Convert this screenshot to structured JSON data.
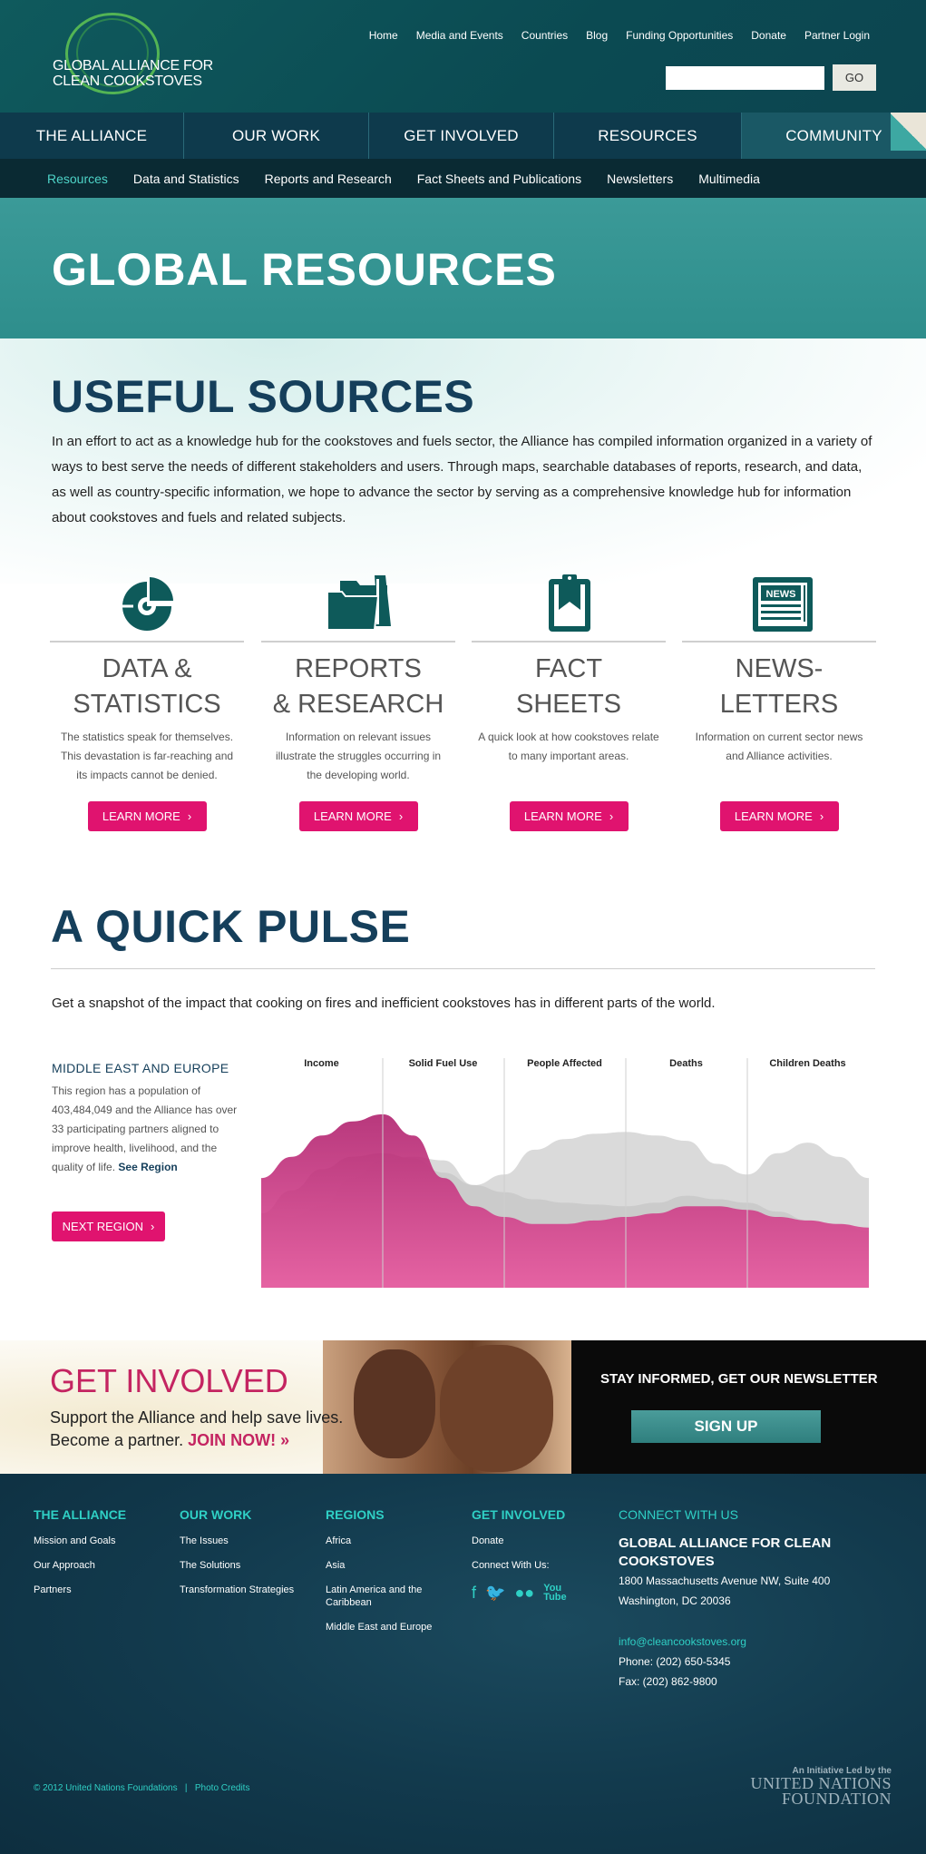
{
  "header": {
    "logo_line1": "GLOBAL ALLIANCE FOR",
    "logo_line2": "CLEAN COOKSTOVES",
    "utility_nav": [
      "Home",
      "Media and Events",
      "Countries",
      "Blog",
      "Funding Opportunities",
      "Donate",
      "Partner Login"
    ],
    "search": {
      "value": "",
      "placeholder": "",
      "button": "GO"
    }
  },
  "main_nav": [
    {
      "label": "THE ALLIANCE",
      "active": false
    },
    {
      "label": "OUR WORK",
      "active": false
    },
    {
      "label": "GET INVOLVED",
      "active": false
    },
    {
      "label": "RESOURCES",
      "active": false
    },
    {
      "label": "COMMUNITY",
      "active": true
    }
  ],
  "sub_nav": {
    "current": "Resources",
    "items": [
      "Resources",
      "Data and Statistics",
      "Reports and Research",
      "Fact Sheets and Publications",
      "Newsletters",
      "Multimedia"
    ]
  },
  "banner": {
    "title": "GLOBAL RESOURCES"
  },
  "useful_sources": {
    "title": "USEFUL SOURCES",
    "text": "In an effort to act as a knowledge hub for the cookstoves and fuels sector, the Alliance has compiled information organized in a variety of ways to best serve the needs of different stakeholders and users. Through maps, searchable databases of reports, research, and data, as well as country-specific information, we hope to advance the sector by serving as a comprehensive knowledge hub for information about cookstoves and fuels and related subjects."
  },
  "resources": [
    {
      "icon": "data-chart-icon",
      "title_1": "DATA &",
      "title_2": "STATISTICS",
      "desc": "The statistics speak for themselves. This devastation is far-reaching and its impacts cannot be denied.",
      "button": "LEARN MORE"
    },
    {
      "icon": "folder-icon",
      "title_1": "REPORTS",
      "title_2": "& RESEARCH",
      "desc": "Information on relevant issues illustrate the struggles occurring in the developing world.",
      "button": "LEARN MORE"
    },
    {
      "icon": "clipboard-icon",
      "title_1": "FACT",
      "title_2": "SHEETS",
      "desc": "A quick look at how cookstoves relate to many important areas.",
      "button": "LEARN MORE"
    },
    {
      "icon": "newspaper-icon",
      "title_1": "NEWS-",
      "title_2": "LETTERS",
      "desc": "Information on current sector news and Alliance activities.",
      "button": "LEARN MORE",
      "icon_text": "NEWS"
    }
  ],
  "pulse": {
    "title": "A QUICK PULSE",
    "intro": "Get a snapshot of the impact that cooking on fires and inefficient cookstoves has in different parts of the world.",
    "region": {
      "name": "MIDDLE EAST AND EUROPE",
      "desc": "This region has a population of 403,484,049 and the Alliance has over 33 participating partners aligned to improve health, livelihood, and the quality of life.",
      "link": "See Region",
      "next_button": "NEXT REGION"
    }
  },
  "chart_data": {
    "type": "area",
    "categories": [
      "Income",
      "Solid Fuel Use",
      "People Affected",
      "Deaths",
      "Children Deaths"
    ],
    "x": [
      0,
      0.25,
      0.5,
      0.75,
      1,
      1.25,
      1.5,
      1.75,
      2,
      2.25,
      2.5,
      2.75,
      3,
      3.25,
      3.5,
      3.75,
      4,
      4.25,
      4.5,
      4.75,
      5
    ],
    "series": [
      {
        "values": [
          42,
          40,
          46,
          62,
          72,
          74,
          72,
          58,
          64,
          78,
          84,
          87,
          88,
          86,
          83,
          70,
          64,
          76,
          82,
          74,
          62
        ],
        "color": "#d4d4d4"
      },
      {
        "values": [
          42,
          55,
          67,
          74,
          76,
          73,
          65,
          58,
          54,
          50,
          48,
          47,
          46,
          48,
          52,
          50,
          48,
          43,
          38,
          36,
          32
        ],
        "color": "#c8c8c8"
      },
      {
        "values": [
          62,
          74,
          86,
          94,
          98,
          86,
          62,
          46,
          40,
          36,
          36,
          38,
          40,
          42,
          46,
          46,
          44,
          40,
          38,
          36,
          34
        ],
        "color": "#d12a83"
      }
    ],
    "ylim": [
      0,
      100
    ],
    "grid": "vertical",
    "legend": "none"
  },
  "get_involved": {
    "title": "GET INVOLVED",
    "line1": "Support the Alliance and help save lives.",
    "line2": "Become a partner.",
    "join": "JOIN NOW! »"
  },
  "newsletter": {
    "title": "STAY INFORMED, GET OUR NEWSLETTER",
    "button": "SIGN UP"
  },
  "footer": {
    "columns": [
      {
        "title": "THE ALLIANCE",
        "links": [
          "Mission and Goals",
          "Our Approach",
          "Partners"
        ]
      },
      {
        "title": "OUR WORK",
        "links": [
          "The Issues",
          "The Solutions",
          "Transformation Strategies"
        ]
      },
      {
        "title": "REGIONS",
        "links": [
          "Africa",
          "Asia",
          "Latin America and the Caribbean",
          "Middle East and Europe"
        ]
      },
      {
        "title": "GET INVOLVED",
        "links": [
          "Donate",
          "Connect With Us:"
        ]
      }
    ],
    "connect": {
      "title": "CONNECT WITH US",
      "org": "GLOBAL ALLIANCE FOR CLEAN COOKSTOVES",
      "address1": "1800 Massachusetts Avenue NW, Suite 400",
      "address2": "Washington, DC 20036",
      "email": "info@cleancookstoves.org",
      "phone": "Phone: (202) 650-5345",
      "fax": "Fax: (202) 862-9800"
    },
    "social_icons": [
      "facebook-icon",
      "twitter-icon",
      "flickr-icon",
      "youtube-icon"
    ],
    "copyright": "© 2012 United Nations Foundations",
    "photo_credits": "Photo Credits",
    "un_small": "An Initiative Led by the",
    "un_line1": "UNITED NATIONS",
    "un_line2": "FOUNDATION"
  },
  "colors": {
    "accent_pink": "#e0136f",
    "nav_dark": "#0e3a4c",
    "teal": "#2fd0c5",
    "heading_blue": "#153f5b"
  }
}
